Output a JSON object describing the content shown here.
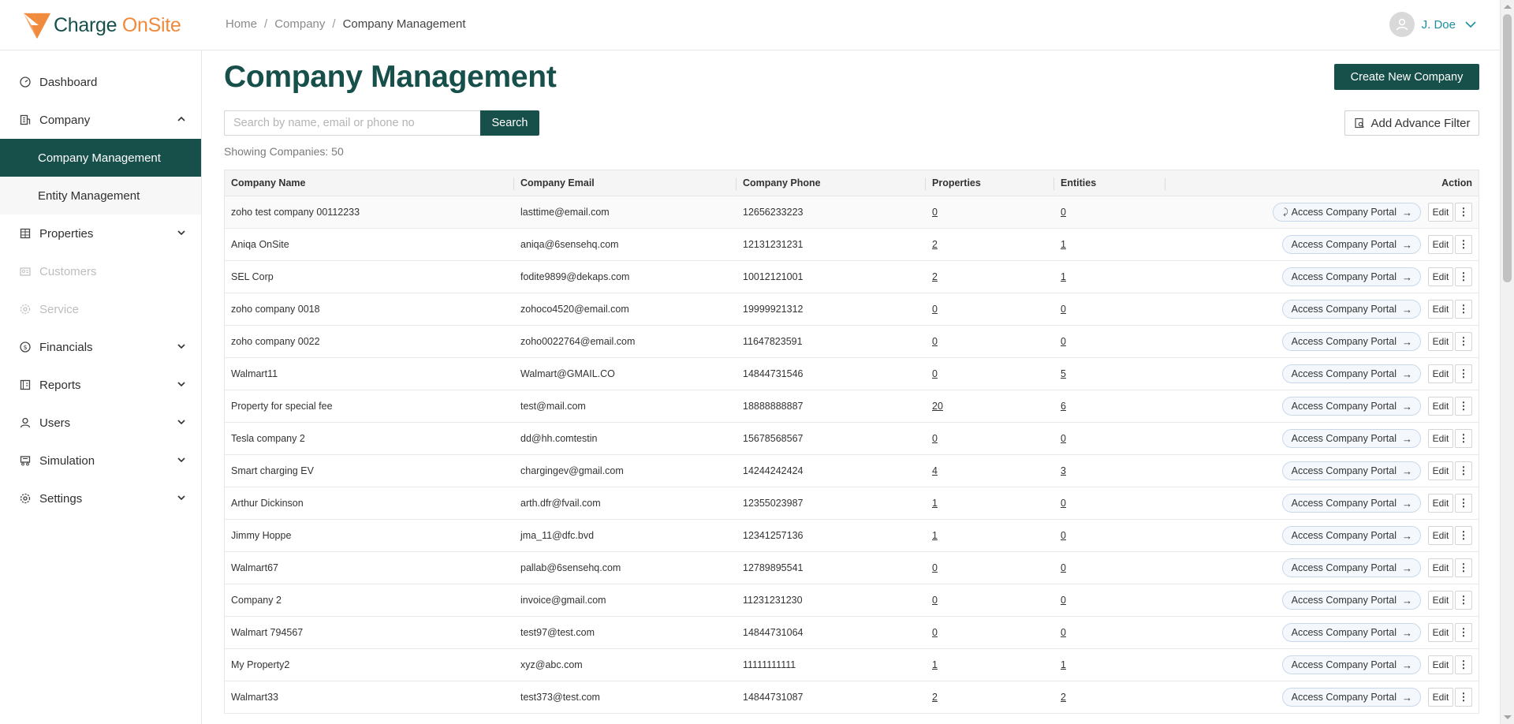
{
  "brand": {
    "name_part1": "Charge ",
    "name_part2": "OnSite",
    "color_primary": "#17504a",
    "color_accent": "#f08a3c"
  },
  "breadcrumb": [
    "Home",
    "Company",
    "Company Management"
  ],
  "user": {
    "name": "J. Doe"
  },
  "sidebar": {
    "items": [
      {
        "label": "Dashboard",
        "icon": "dashboard-gauge-icon"
      },
      {
        "label": "Company",
        "icon": "building-icon",
        "expanded": true,
        "children": [
          {
            "label": "Company Management",
            "active": true
          },
          {
            "label": "Entity Management"
          }
        ]
      },
      {
        "label": "Properties",
        "icon": "grid-icon"
      },
      {
        "label": "Customers",
        "icon": "id-card-icon",
        "disabled": true
      },
      {
        "label": "Service",
        "icon": "gear-icon",
        "disabled": true
      },
      {
        "label": "Financials",
        "icon": "dollar-circle-icon"
      },
      {
        "label": "Reports",
        "icon": "report-icon"
      },
      {
        "label": "Users",
        "icon": "user-icon"
      },
      {
        "label": "Simulation",
        "icon": "simulation-icon"
      },
      {
        "label": "Settings",
        "icon": "gear-icon"
      }
    ]
  },
  "page": {
    "title": "Company Management",
    "create_label": "Create New Company",
    "search_placeholder": "Search by name, email or phone no",
    "search_label": "Search",
    "filter_label": "Add Advance Filter",
    "showing": "Showing Companies: 50"
  },
  "table": {
    "headers": [
      "Company Name",
      "Company Email",
      "Company Phone",
      "Properties",
      "Entities",
      "Action"
    ],
    "portal_label": "Access Company Portal",
    "edit_label": "Edit",
    "rows": [
      {
        "name": "zoho test company 00112233",
        "email": "lasttime@email.com",
        "phone": "12656233223",
        "properties": "0",
        "entities": "0",
        "loading": true
      },
      {
        "name": "Aniqa OnSite",
        "email": "aniqa@6sensehq.com",
        "phone": "12131231231",
        "properties": "2",
        "entities": "1"
      },
      {
        "name": "SEL Corp",
        "email": "fodite9899@dekaps.com",
        "phone": "10012121001",
        "properties": "2",
        "entities": "1"
      },
      {
        "name": "zoho company 0018",
        "email": "zohoco4520@email.com",
        "phone": "19999921312",
        "properties": "0",
        "entities": "0"
      },
      {
        "name": "zoho company 0022",
        "email": "zoho0022764@email.com",
        "phone": "11647823591",
        "properties": "0",
        "entities": "0"
      },
      {
        "name": "Walmart11",
        "email": "Walmart@GMAIL.CO",
        "phone": "14844731546",
        "properties": "0",
        "entities": "5"
      },
      {
        "name": "Property for special fee",
        "email": "test@mail.com",
        "phone": "18888888887",
        "properties": "20",
        "entities": "6"
      },
      {
        "name": "Tesla company 2",
        "email": "dd@hh.comtestin",
        "phone": "15678568567",
        "properties": "0",
        "entities": "0"
      },
      {
        "name": "Smart charging EV",
        "email": "chargingev@gmail.com",
        "phone": "14244242424",
        "properties": "4",
        "entities": "3"
      },
      {
        "name": "Arthur Dickinson",
        "email": "arth.dfr@fvail.com",
        "phone": "12355023987",
        "properties": "1",
        "entities": "0"
      },
      {
        "name": "Jimmy Hoppe",
        "email": "jma_11@dfc.bvd",
        "phone": "12341257136",
        "properties": "1",
        "entities": "0"
      },
      {
        "name": "Walmart67",
        "email": "pallab@6sensehq.com",
        "phone": "12789895541",
        "properties": "0",
        "entities": "0"
      },
      {
        "name": "Company 2",
        "email": "invoice@gmail.com",
        "phone": "11231231230",
        "properties": "0",
        "entities": "0"
      },
      {
        "name": "Walmart 794567",
        "email": "test97@test.com",
        "phone": "14844731064",
        "properties": "0",
        "entities": "0"
      },
      {
        "name": "My Property2",
        "email": "xyz@abc.com",
        "phone": "11111111111",
        "properties": "1",
        "entities": "1"
      },
      {
        "name": "Walmart33",
        "email": "test373@test.com",
        "phone": "14844731087",
        "properties": "2",
        "entities": "2"
      }
    ]
  }
}
